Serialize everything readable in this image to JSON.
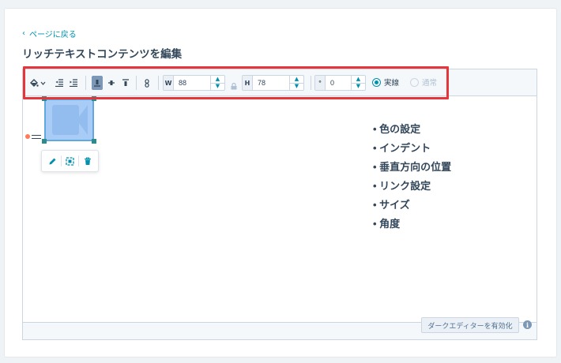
{
  "page": {
    "back_link": "ページに戻る",
    "title": "リッチテキストコンテンツを編集"
  },
  "toolbar": {
    "icons": [
      "paint-bucket-icon",
      "chevron-down-icon",
      "outdent-icon",
      "indent-icon",
      "align-bottom-icon",
      "align-middle-icon",
      "align-top-icon",
      "link-icon",
      "lock-icon"
    ],
    "width_prefix": "W",
    "width_value": "88",
    "height_prefix": "H",
    "height_value": "78",
    "angle_prefix": "°",
    "angle_value": "0",
    "solid_label": "実線",
    "normal_label": "通常",
    "selected_border": "solid"
  },
  "image_popover": {
    "icons": [
      "pencil-icon",
      "replace-icon",
      "trash-icon"
    ]
  },
  "content": {
    "bullets": [
      "• 色の設定",
      "• インデント",
      "• 垂直方向の位置",
      "• リンク設定",
      "• サイズ",
      "• 角度"
    ]
  },
  "footer": {
    "dark_editor_button": "ダークエディターを有効化",
    "info_icon_glyph": "i"
  },
  "colors": {
    "accent": "#0091ae",
    "highlight": "#e5363b",
    "text": "#33475b"
  }
}
